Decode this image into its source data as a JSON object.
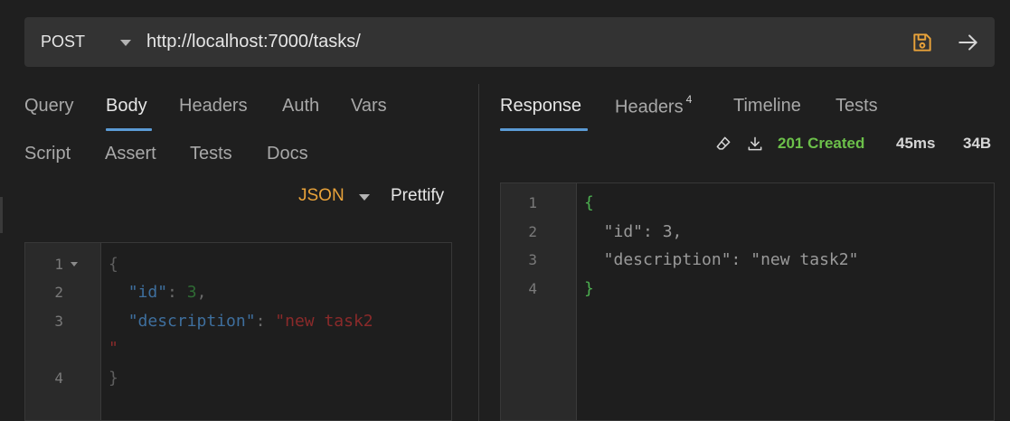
{
  "request": {
    "method": "POST",
    "url": "http://localhost:7000/tasks/"
  },
  "request_tabs": [
    {
      "label": "Query",
      "active": false
    },
    {
      "label": "Body",
      "active": true
    },
    {
      "label": "Headers",
      "active": false
    },
    {
      "label": "Auth",
      "active": false
    },
    {
      "label": "Vars",
      "active": false
    },
    {
      "label": "Script",
      "active": false
    },
    {
      "label": "Assert",
      "active": false
    },
    {
      "label": "Tests",
      "active": false
    },
    {
      "label": "Docs",
      "active": false
    }
  ],
  "body_toolbar": {
    "mode": "JSON",
    "prettify_label": "Prettify"
  },
  "request_editor": {
    "line_numbers": [
      "1",
      "2",
      "3",
      "4"
    ],
    "lines": {
      "l1_brace": "{",
      "l2_key": "\"id\"",
      "l2_colon": ": ",
      "l2_value": "3",
      "l2_comma": ",",
      "l3_key": "\"description\"",
      "l3_colon": ": ",
      "l3_value": "\"new task2",
      "l3_wrap": "\"",
      "l4_brace": "}"
    }
  },
  "response_tabs": [
    {
      "label": "Response",
      "active": true
    },
    {
      "label": "Headers",
      "active": false,
      "count": "4"
    },
    {
      "label": "Timeline",
      "active": false
    },
    {
      "label": "Tests",
      "active": false
    }
  ],
  "response_status": {
    "code": "201 Created",
    "time": "45ms",
    "size": "34B"
  },
  "response_editor": {
    "line_numbers": [
      "1",
      "2",
      "3",
      "4"
    ],
    "lines": [
      "{",
      "  \"id\": 3,",
      "  \"description\": \"new task2\"",
      "}"
    ]
  },
  "colors": {
    "accent": "#5b9bd5",
    "status_success": "#6cc04a",
    "json_mode": "#e8a23a",
    "save_icon": "#e8a23a"
  },
  "icons": {
    "save": "floppy-disk-icon",
    "send": "arrow-right-icon",
    "clear": "eraser-icon",
    "download": "download-icon"
  }
}
